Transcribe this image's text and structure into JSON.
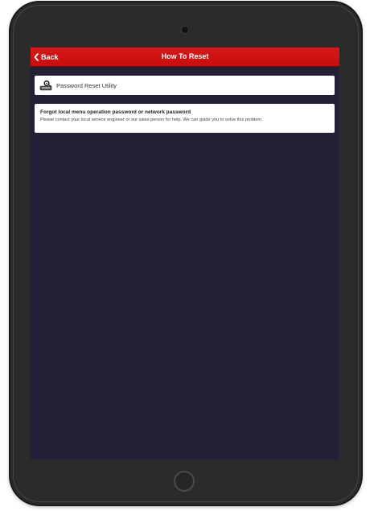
{
  "nav": {
    "back_label": "Back",
    "title": "How To Reset"
  },
  "utility": {
    "label": "Password Reset Utility",
    "icon": "password-utility-icon"
  },
  "info": {
    "title": "Forgot local menu operation password or network password",
    "body": "Please contact your local service engineer or our sales person for help. We can guide you to solve this problem."
  },
  "colors": {
    "nav_bar": "#d01010",
    "screen_background": "#231f37",
    "card_background": "#ffffff",
    "device_frame": "#2b2b2b"
  }
}
